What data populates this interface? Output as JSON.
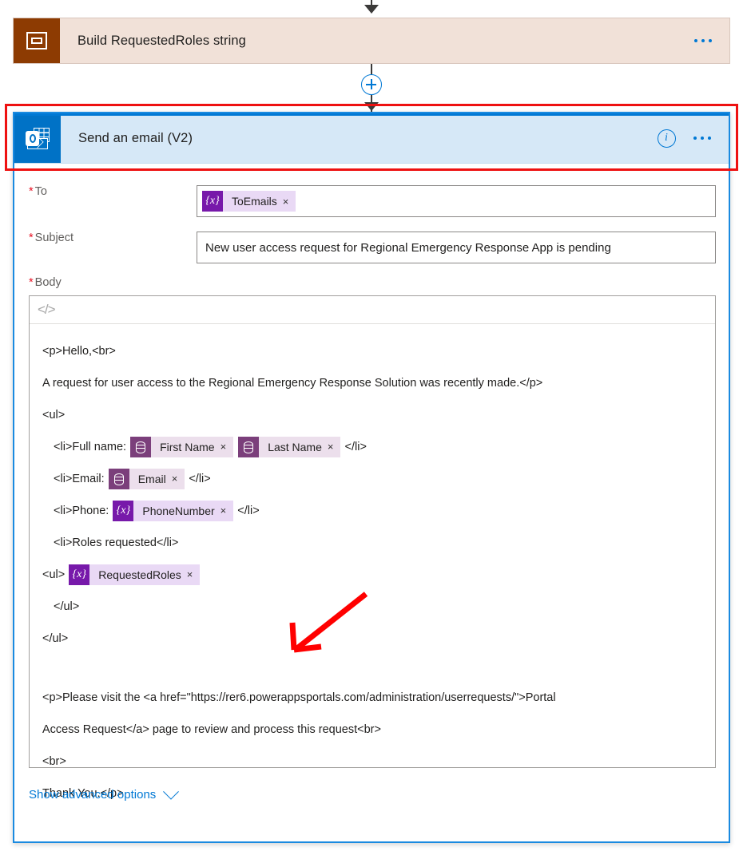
{
  "flow": {
    "previous_step": {
      "title": "Build RequestedRoles string",
      "icon": "variable-icon",
      "more_actions": "more-options",
      "background_color": "#f1e1d8",
      "icon_color": "#8d3b02"
    },
    "connector": {
      "add_step_label": "+",
      "icon": "plus-circle-icon"
    },
    "selected_step": {
      "title": "Send an email (V2)",
      "icon": "outlook-icon",
      "icon_color": "#0072c6",
      "header_color": "#d6e8f7",
      "border_color": "#1a8ae0",
      "info_icon": "info-icon",
      "more_actions": "more-options"
    }
  },
  "highlight": {
    "color": "#ee1111",
    "annotation_arrow_color": "#ff0000"
  },
  "form": {
    "to": {
      "label": "To",
      "required_marker": "*",
      "tokens": [
        {
          "type": "variable",
          "icon": "variable-token-icon",
          "label": "ToEmails",
          "remove": "×"
        }
      ]
    },
    "subject": {
      "label": "Subject",
      "required_marker": "*",
      "value": "New user access request for Regional Emergency Response App is pending"
    },
    "body": {
      "label": "Body",
      "required_marker": "*",
      "toolbar_icon": "code-view-icon",
      "lines": [
        {
          "id": "l1",
          "text": "<p>Hello,<br>"
        },
        {
          "id": "l2",
          "text": "A request for user access to the Regional Emergency Response Solution was recently made.</p>"
        },
        {
          "id": "l3",
          "text": "<ul>"
        },
        {
          "id": "l4",
          "prefix": "<li>Full name:",
          "suffix": "</li>",
          "tokens": [
            {
              "type": "dataverse",
              "icon": "database-token-icon",
              "label": "First Name",
              "remove": "×"
            },
            {
              "type": "dataverse",
              "icon": "database-token-icon",
              "label": "Last Name",
              "remove": "×"
            }
          ]
        },
        {
          "id": "l5",
          "prefix": "<li>Email:",
          "suffix": "</li>",
          "tokens": [
            {
              "type": "dataverse",
              "icon": "database-token-icon",
              "label": "Email",
              "remove": "×"
            }
          ]
        },
        {
          "id": "l6",
          "prefix": "<li>Phone:",
          "suffix": "</li>",
          "tokens": [
            {
              "type": "variable",
              "icon": "variable-token-icon",
              "label": "PhoneNumber",
              "remove": "×"
            }
          ]
        },
        {
          "id": "l7",
          "text": "<li>Roles requested</li>"
        },
        {
          "id": "l8",
          "prefix": "<ul>",
          "suffix": "",
          "tokens": [
            {
              "type": "variable",
              "icon": "variable-token-icon",
              "label": "RequestedRoles",
              "remove": "×"
            }
          ]
        },
        {
          "id": "l9",
          "text": "</ul>"
        },
        {
          "id": "l10",
          "text": "</ul>"
        },
        {
          "id": "l11",
          "text": ""
        },
        {
          "id": "l12",
          "text": "<p>Please visit the <a href=\"https://rer6.powerappsportals.com/administration/userrequests/\">Portal"
        },
        {
          "id": "l13",
          "text": "Access Request</a> page to review and process this request<br>"
        },
        {
          "id": "l14",
          "text": "<br>"
        },
        {
          "id": "l15",
          "text": "Thank You.</p>"
        }
      ]
    },
    "advanced_options": {
      "label": "Show advanced options",
      "icon": "chevron-down-icon"
    }
  }
}
